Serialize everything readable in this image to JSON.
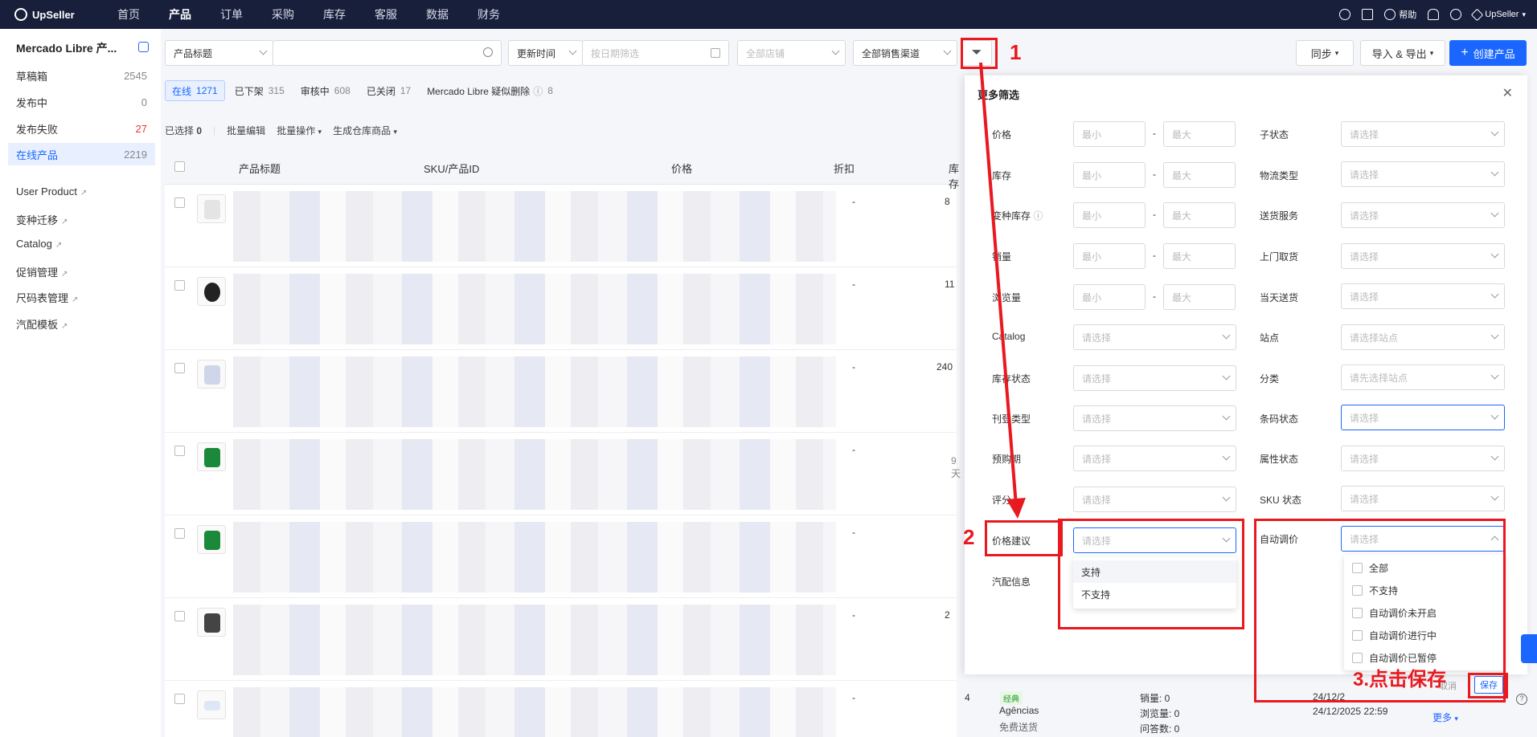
{
  "brand": "UpSeller",
  "nav": {
    "items": [
      "首页",
      "产品",
      "订单",
      "采购",
      "库存",
      "客服",
      "数据",
      "财务"
    ],
    "active": "产品",
    "help": "帮助",
    "user": "UpSeller"
  },
  "sidebar": {
    "title": "Mercado Libre 产...",
    "items": [
      {
        "label": "草稿箱",
        "count": "2545"
      },
      {
        "label": "发布中",
        "count": "0"
      },
      {
        "label": "发布失败",
        "count": "27"
      },
      {
        "label": "在线产品",
        "count": "2219"
      }
    ],
    "links": [
      "User Product",
      "变种迁移",
      "Catalog",
      "促销管理",
      "尺码表管理",
      "汽配模板"
    ]
  },
  "toolbar": {
    "field_select": "产品标题",
    "time_select": "更新时间",
    "date_placeholder": "按日期筛选",
    "store_placeholder": "全部店铺",
    "channel_select": "全部销售渠道",
    "sync": "同步",
    "import_export": "导入 & 导出",
    "create": "创建产品"
  },
  "tabs": [
    {
      "label": "在线",
      "count": "1271"
    },
    {
      "label": "已下架",
      "count": "315"
    },
    {
      "label": "审核中",
      "count": "608"
    },
    {
      "label": "已关闭",
      "count": "17"
    },
    {
      "label": "Mercado Libre 疑似删除",
      "count": "8"
    }
  ],
  "bulk": {
    "selected": "已选择",
    "selected_count": "0",
    "edit": "批量编辑",
    "ops": "批量操作",
    "gen": "生成仓库商品"
  },
  "table": {
    "headers": [
      "产品标题",
      "SKU/产品ID",
      "价格",
      "折扣",
      "库存"
    ],
    "rows": [
      {
        "discount": "-",
        "stock": "8",
        "extra": ""
      },
      {
        "discount": "-",
        "stock": "11",
        "extra": ""
      },
      {
        "discount": "-",
        "stock": "240",
        "extra": ""
      },
      {
        "discount": "-",
        "stock": "",
        "extra": "9 天"
      },
      {
        "discount": "-",
        "stock": "",
        "extra": ""
      },
      {
        "discount": "-",
        "stock": "2",
        "extra": ""
      },
      {
        "discount": "-",
        "stock": "4",
        "extra": ""
      }
    ],
    "last_row": {
      "badge": "经典",
      "channel": "Agências",
      "shipping": "免费送货",
      "sales": "销量: 0",
      "views": "浏览量: 0",
      "qa": "问答数: 0",
      "date1": "24/12/2",
      "date2": "24/12/2025 22:59",
      "more": "更多"
    }
  },
  "panel": {
    "title": "更多筛选",
    "min": "最小",
    "max": "最大",
    "select": "请选择",
    "select_site": "请选择站点",
    "select_site_first": "请先选择站点",
    "left_labels": [
      "价格",
      "库存",
      "变种库存",
      "销量",
      "浏览量",
      "Catalog",
      "库存状态",
      "刊登类型",
      "预购期",
      "评分",
      "价格建议",
      "汽配信息"
    ],
    "right_labels": [
      "子状态",
      "物流类型",
      "送货服务",
      "上门取货",
      "当天送货",
      "站点",
      "分类",
      "条码状态",
      "属性状态",
      "SKU 状态",
      "自动调价"
    ],
    "price_suggest_options": [
      "支持",
      "不支持"
    ],
    "auto_price_options": [
      "全部",
      "不支持",
      "自动调价未开启",
      "自动调价进行中",
      "自动调价已暂停"
    ],
    "cancel": "取消",
    "save": "保存"
  },
  "annotations": {
    "n1": "1",
    "n2": "2",
    "n3": "3.点击保存",
    "color": "#e8191f"
  }
}
